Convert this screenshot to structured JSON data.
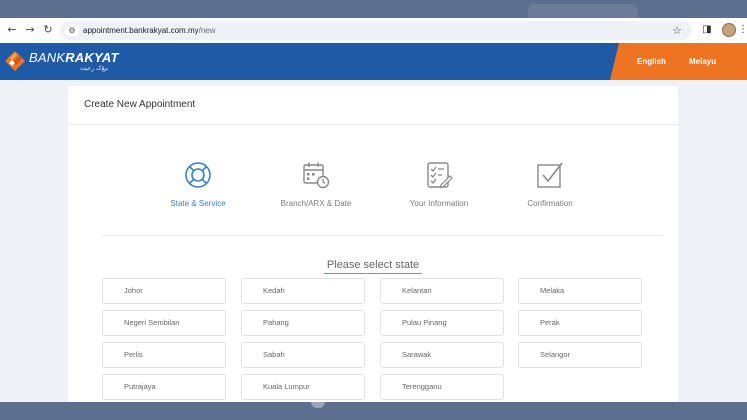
{
  "browser": {
    "url_host": "appointment.bankrakyat.com.my",
    "url_path": "/new"
  },
  "header": {
    "logo_bank": "BANK",
    "logo_rakyat": "RAKYAT",
    "logo_jawi": "بيڠ‌ک رعيت",
    "languages": [
      "English",
      "Melayu"
    ]
  },
  "form": {
    "title": "Create New Appointment",
    "steps": [
      {
        "label": "State & Service",
        "icon": "lifebuoy-icon",
        "active": true
      },
      {
        "label": "Branch/ARX & Date",
        "icon": "calendar-clock-icon",
        "active": false
      },
      {
        "label": "Your Information",
        "icon": "checklist-pen-icon",
        "active": false
      },
      {
        "label": "Confirmation",
        "icon": "checkbox-confirm-icon",
        "active": false
      }
    ],
    "prompt": "Please select state",
    "states": [
      "Johor",
      "Kedah",
      "Kelantan",
      "Melaka",
      "Negeri Sembilan",
      "Pahang",
      "Pulau Pinang",
      "Perak",
      "Perlis",
      "Sabah",
      "Sarawak",
      "Selangor",
      "Putrajaya",
      "Kuala Lumpur",
      "Terengganu"
    ]
  },
  "colors": {
    "brand_blue": "#1f5aa6",
    "brand_orange": "#ee7422",
    "active_step": "#3b82c4"
  }
}
